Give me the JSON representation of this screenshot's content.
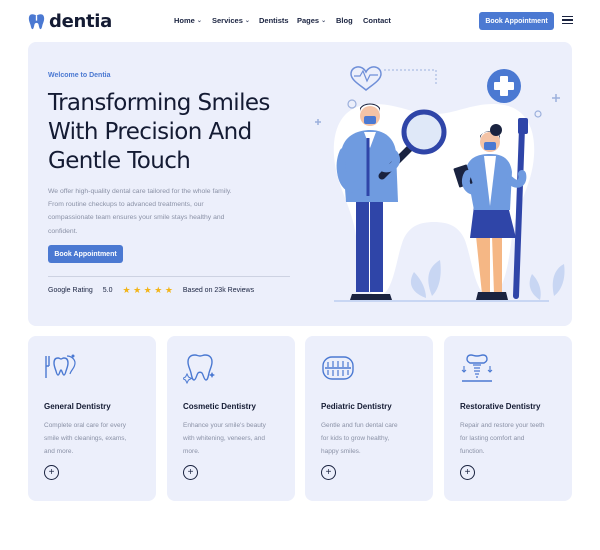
{
  "brand": {
    "name": "dentia",
    "logo_icon": "tooth-icon",
    "color": "#4b79d2"
  },
  "nav": {
    "items": [
      {
        "label": "Home",
        "has_dropdown": true
      },
      {
        "label": "Services",
        "has_dropdown": true
      },
      {
        "label": "Dentists",
        "has_dropdown": false
      },
      {
        "label": "Pages",
        "has_dropdown": true
      },
      {
        "label": "Blog",
        "has_dropdown": false
      },
      {
        "label": "Contact",
        "has_dropdown": false
      }
    ],
    "cta_label": "Book Appointment",
    "menu_icon": "hamburger-menu-icon"
  },
  "hero": {
    "kicker": "Welcome to Dentia",
    "title_lines": [
      "Transforming Smiles",
      "With Precision And",
      "Gentle Touch"
    ],
    "description_lines": [
      "We offer high-quality dental care tailored for the whole family.",
      "From routine checkups to advanced treatments, our",
      "compassionate team ensures your smile stays healthy and",
      "confident."
    ],
    "cta_label": "Book Appointment",
    "rating": {
      "label": "Google Rating",
      "score": "5.0",
      "stars": 5,
      "reviews": "Based on 23k Reviews"
    },
    "illustration": "dentists-with-tooth-illustration"
  },
  "services": [
    {
      "icon": "teeth-tools-icon",
      "title": "General Dentistry",
      "description_lines": [
        "Complete oral care for every",
        "smile with cleanings, exams,",
        "and more."
      ],
      "action_icon": "plus-icon"
    },
    {
      "icon": "sparkle-tooth-icon",
      "title": "Cosmetic Dentistry",
      "description_lines": [
        "Enhance your smile's beauty",
        "with whitening, veneers, and",
        "more."
      ],
      "action_icon": "plus-icon"
    },
    {
      "icon": "braces-icon",
      "title": "Pediatric Dentistry",
      "description_lines": [
        "Gentle and fun dental care",
        "for kids to grow healthy,",
        "happy smiles."
      ],
      "action_icon": "plus-icon"
    },
    {
      "icon": "dental-implant-icon",
      "title": "Restorative Dentistry",
      "description_lines": [
        "Repair and restore your teeth",
        "for lasting comfort and",
        "function."
      ],
      "action_icon": "plus-icon"
    }
  ],
  "colors": {
    "accent": "#4b79d2",
    "panel": "#eceffb",
    "star": "#f2b418",
    "heading": "#141b33",
    "muted_text": "#8a91a6"
  }
}
